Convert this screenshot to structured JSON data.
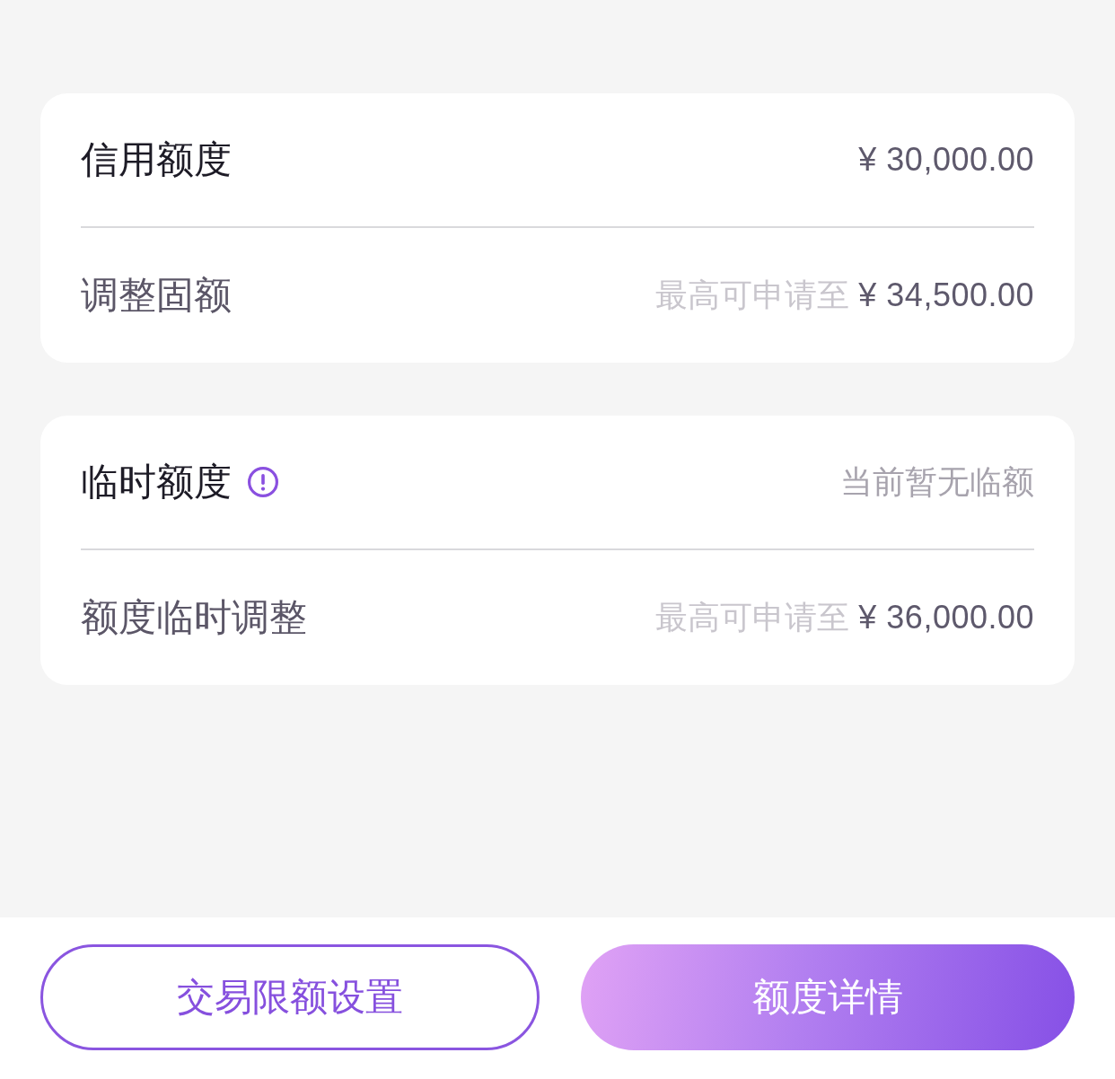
{
  "sections": [
    {
      "rows": [
        {
          "kind": "main",
          "label": "信用额度",
          "value": "¥ 30,000.00"
        },
        {
          "kind": "sub",
          "label": "调整固额",
          "hint": "最高可申请至",
          "value": "¥ 34,500.00"
        }
      ]
    },
    {
      "rows": [
        {
          "kind": "main",
          "label": "临时额度",
          "info": true,
          "note": "当前暂无临额"
        },
        {
          "kind": "sub",
          "label": "额度临时调整",
          "hint": "最高可申请至",
          "value": "¥ 36,000.00"
        }
      ]
    }
  ],
  "buttons": [
    {
      "kind": "outline",
      "label": "交易限额设置"
    },
    {
      "kind": "filled",
      "label": "额度详情"
    }
  ]
}
